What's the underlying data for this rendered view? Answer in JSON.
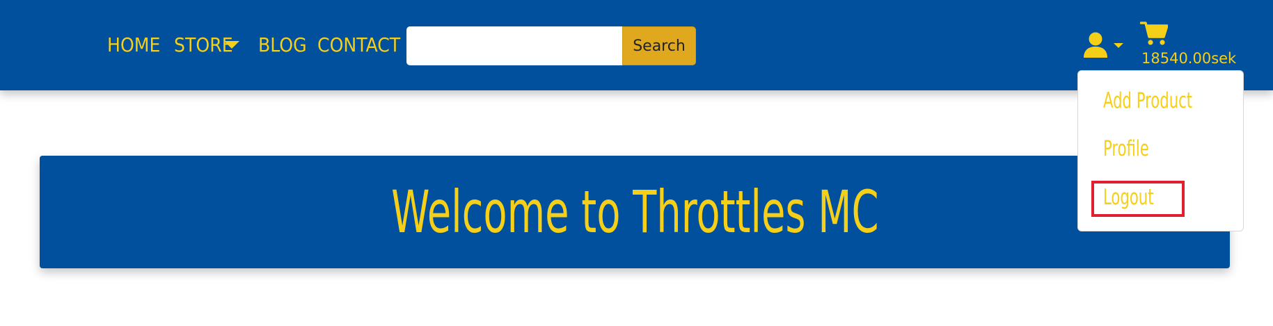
{
  "nav": {
    "items": [
      {
        "label": "HOME"
      },
      {
        "label": "STORE"
      },
      {
        "label": "BLOG"
      },
      {
        "label": "CONTACT"
      }
    ]
  },
  "search": {
    "placeholder": "",
    "value": "",
    "button_label": "Search"
  },
  "user_menu": {
    "icon": "user-icon",
    "items": [
      {
        "label": "Add Product"
      },
      {
        "label": "Profile"
      },
      {
        "label": "Logout"
      }
    ]
  },
  "cart": {
    "icon": "cart-icon",
    "total": "18540.00sek"
  },
  "hero": {
    "title": "Welcome to Throttles MC"
  },
  "colors": {
    "brand_blue": "#00509e",
    "accent_yellow": "#f6cf18",
    "search_button": "#e0a81f",
    "highlight_red": "#e0202e"
  }
}
